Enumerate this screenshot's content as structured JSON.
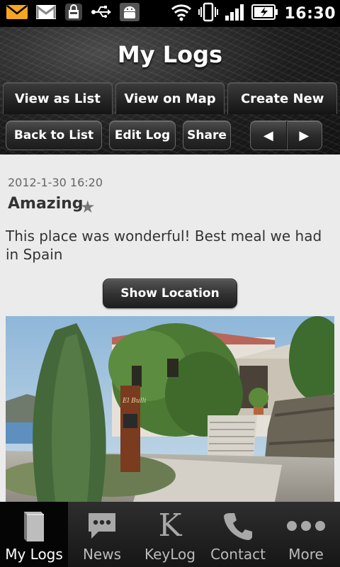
{
  "status_bar": {
    "time": "16:30",
    "left_icons": [
      "email-notification-icon",
      "gmail-icon",
      "lock-bag-icon",
      "usb-icon",
      "android-icon"
    ],
    "right_icons": [
      "wifi-icon",
      "vibrate-icon",
      "signal-icon",
      "battery-charging-icon"
    ]
  },
  "header": {
    "title": "My Logs",
    "tabs": [
      {
        "label": "View as List"
      },
      {
        "label": "View on Map"
      },
      {
        "label": "Create New"
      }
    ],
    "toolbar": {
      "back_label": "Back to List",
      "edit_label": "Edit Log",
      "share_label": "Share",
      "prev_icon": "triangle-left-icon",
      "next_icon": "triangle-right-icon"
    }
  },
  "log": {
    "date": "2012-1-30 16:20",
    "title": "Amazing",
    "description": "This place was wonderful! Best meal we had in Spain",
    "show_location_label": "Show Location",
    "photo_sign_text": "El Bulli"
  },
  "bottom_nav": {
    "items": [
      {
        "label": "My Logs",
        "icon": "book-icon",
        "active": true
      },
      {
        "label": "News",
        "icon": "chat-bubble-icon",
        "active": false
      },
      {
        "label": "KeyLog",
        "icon": "keylog-k-icon",
        "active": false
      },
      {
        "label": "Contact",
        "icon": "phone-icon",
        "active": false
      },
      {
        "label": "More",
        "icon": "more-dots-icon",
        "active": false
      }
    ]
  },
  "colors": {
    "content_bg": "#ebebeb",
    "statusbar_bg": "#000000",
    "accent_orange": "#f5a623"
  }
}
